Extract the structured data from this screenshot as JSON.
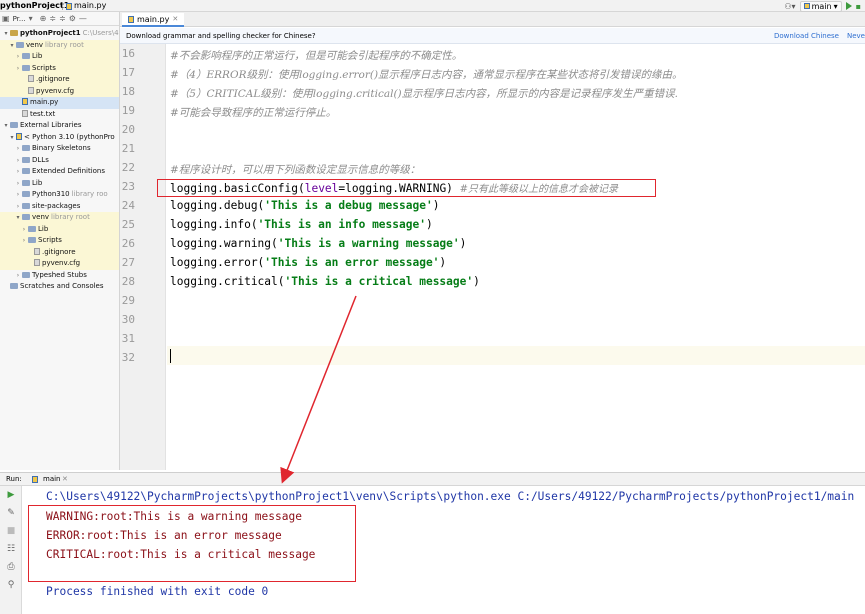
{
  "topbar": {
    "project": "pythonProject1",
    "file": "main.py",
    "run_config": "main",
    "dropdown_arrow": "▾"
  },
  "project_panel": {
    "title": "Pr...",
    "items": [
      {
        "label": "pythonProject1",
        "extra": "C:\\Users\\4",
        "icon": "folder"
      },
      {
        "label": "venv",
        "extra": "library root",
        "icon": "folder"
      },
      {
        "label": "Lib",
        "extra": "",
        "icon": "folder"
      },
      {
        "label": "Scripts",
        "extra": "",
        "icon": "folder"
      },
      {
        "label": ".gitignore",
        "extra": "",
        "icon": "file"
      },
      {
        "label": "pyvenv.cfg",
        "extra": "",
        "icon": "file"
      },
      {
        "label": "main.py",
        "extra": "",
        "icon": "python-file"
      },
      {
        "label": "test.txt",
        "extra": "",
        "icon": "file"
      },
      {
        "label": "External Libraries",
        "extra": "",
        "icon": "library"
      },
      {
        "label": "< Python 3.10 (pythonPro",
        "extra": "",
        "icon": "python"
      },
      {
        "label": "Binary Skeletons",
        "extra": "",
        "icon": "folder"
      },
      {
        "label": "DLLs",
        "extra": "",
        "icon": "folder"
      },
      {
        "label": "Extended Definitions",
        "extra": "",
        "icon": "folder"
      },
      {
        "label": "Lib",
        "extra": "",
        "icon": "folder"
      },
      {
        "label": "Python310",
        "extra": "library roo",
        "icon": "folder"
      },
      {
        "label": "site-packages",
        "extra": "",
        "icon": "folder"
      },
      {
        "label": "venv",
        "extra": "library root",
        "icon": "folder"
      },
      {
        "label": "Lib",
        "extra": "",
        "icon": "folder"
      },
      {
        "label": "Scripts",
        "extra": "",
        "icon": "folder"
      },
      {
        "label": ".gitignore",
        "extra": "",
        "icon": "file"
      },
      {
        "label": "pyvenv.cfg",
        "extra": "",
        "icon": "file"
      },
      {
        "label": "Typeshed Stubs",
        "extra": "",
        "icon": "folder"
      },
      {
        "label": "Scratches and Consoles",
        "extra": "",
        "icon": "scratches"
      }
    ]
  },
  "editor": {
    "tab_label": "main.py",
    "notice_text": "Download grammar and spelling checker for Chinese?",
    "notice_link_download": "Download Chinese",
    "notice_link_never": "Never",
    "line_numbers": [
      "16",
      "17",
      "18",
      "19",
      "20",
      "21",
      "22",
      "23",
      "24",
      "25",
      "26",
      "27",
      "28",
      "29",
      "30",
      "31",
      "32"
    ],
    "lines": {
      "l16": "#不会影响程序的正常运行，但是可能会引起程序的不确定性。",
      "l17": "#（4）ERROR级别：使用logging.error()显示程序日志内容，通常显示程序在某些状态将引发错误的缘由。",
      "l18": "#（5）CRITICAL级别：使用logging.critical()显示程序日志内容，所显示的内容是记录程序发生严重错误.",
      "l19": "#可能会导致程序的正常运行停止。",
      "l22": "#程序设计时，可以用下列函数设定显示信息的等级：",
      "l23_a": "logging.basicConfig(",
      "l23_kw": "level",
      "l23_b": "=logging.WARNING) ",
      "l23_cmt": "#只有此等级以上的信息才会被记录",
      "l24_a": "logging.debug(",
      "l24_s": "'This is a debug message'",
      "l24_b": ")",
      "l25_a": "logging.info(",
      "l25_s": "'This is an info message'",
      "l25_b": ")",
      "l26_a": "logging.warning(",
      "l26_s": "'This is a warning message'",
      "l26_b": ")",
      "l27_a": "logging.error(",
      "l27_s": "'This is an error message'",
      "l27_b": ")",
      "l28_a": "logging.critical(",
      "l28_s": "'This is a critical message'",
      "l28_b": ")"
    }
  },
  "run_panel": {
    "label": "Run:",
    "config": "main",
    "command": "C:\\Users\\49122\\PycharmProjects\\pythonProject1\\venv\\Scripts\\python.exe C:/Users/49122/PycharmProjects/pythonProject1/main",
    "output": [
      "WARNING:root:This is a warning message",
      "ERROR:root:This is an error message",
      "CRITICAL:root:This is a critical message"
    ],
    "finished": "Process finished with exit code 0"
  },
  "colors": {
    "highlight_box": "#e0262e",
    "string": "#067d17",
    "comment": "#8c8c8c",
    "console_cmd": "#1f36a6",
    "console_err": "#8b0f17"
  }
}
